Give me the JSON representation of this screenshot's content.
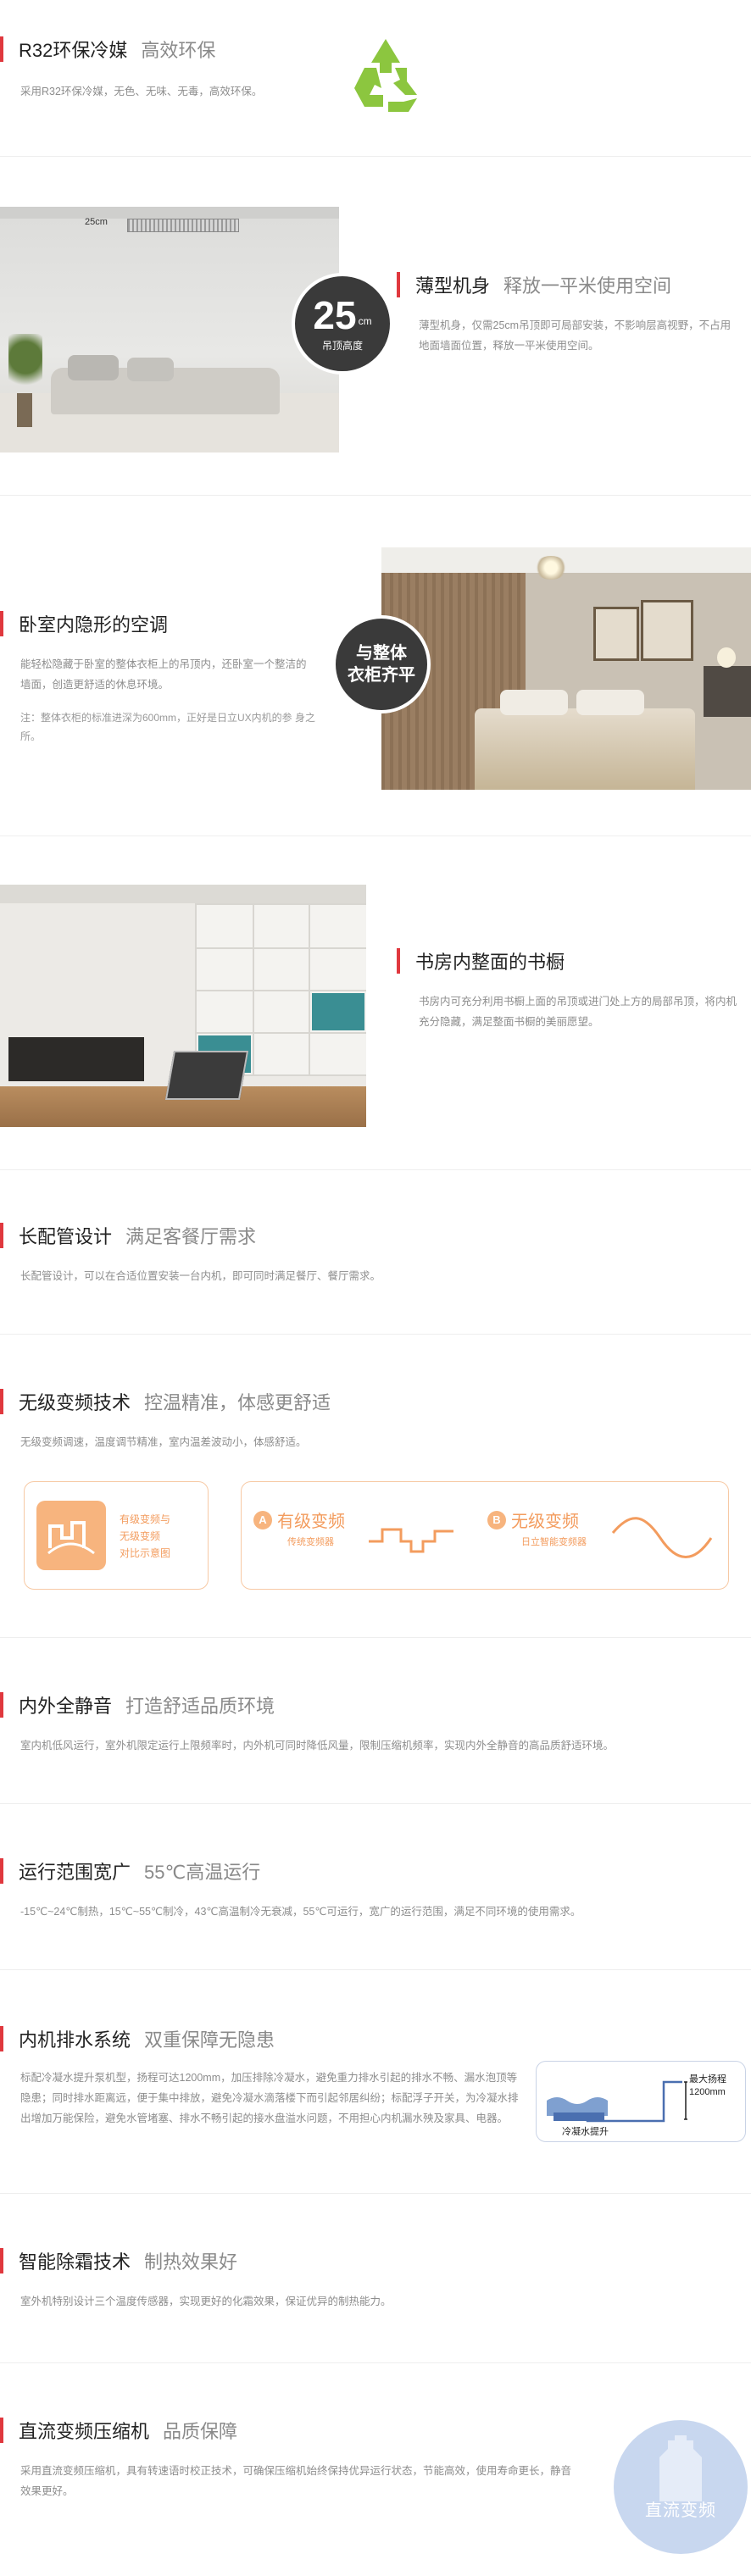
{
  "eco": {
    "title": "R32环保冷媒",
    "subtitle": "高效环保",
    "desc": "采用R32环保冷媒，无色、无味、无毒，高效环保。"
  },
  "slim": {
    "dim_label": "25cm",
    "badge_value": "25",
    "badge_unit": "cm",
    "badge_caption": "吊顶高度",
    "title": "薄型机身",
    "subtitle": "释放一平米使用空间",
    "desc": "薄型机身，仅需25cm吊顶即可局部安装，不影响层高视野，不占用地面墙面位置，释放一平米使用空间。"
  },
  "bedroom": {
    "title": "卧室内隐形的空调",
    "badge_line1": "与整体",
    "badge_line2": "衣柜齐平",
    "desc": "能轻松隐藏于卧室的整体衣柜上的吊顶内，还卧室一个整洁的墙面，创造更舒适的休息环境。",
    "note": "注：整体衣柜的标准进深为600mm，正好是日立UX内机的参 身之所。"
  },
  "study": {
    "title": "书房内整面的书橱",
    "desc": "书房内可充分利用书橱上面的吊顶或进门处上方的局部吊顶，将内机充分隐藏，满足整面书橱的美丽愿望。"
  },
  "pipe": {
    "title": "长配管设计",
    "subtitle": "满足客餐厅需求",
    "desc": "长配管设计，可以在合适位置安装一台内机，即可同时满足餐厅、餐厅需求。"
  },
  "inverter": {
    "title": "无级变频技术",
    "subtitle": "控温精准，体感更舒适",
    "desc": "无级变频调速，温度调节精准，室内温差波动小，体感舒适。",
    "legend_line1": "有级变频与",
    "legend_line2": "无级变频",
    "legend_line3": "对比示意图",
    "a_letter": "A",
    "a_title": "有级变频",
    "a_sub": "传统变频器",
    "b_letter": "B",
    "b_title": "无级变频",
    "b_sub": "日立智能变频器"
  },
  "silent": {
    "title": "内外全静音",
    "subtitle": "打造舒适品质环境",
    "desc": "室内机低风运行，室外机限定运行上限频率时，内外机可同时降低风量，限制压缩机频率，实现内外全静音的高品质舒适环境。"
  },
  "range": {
    "title": "运行范围宽广",
    "subtitle": "55℃高温运行",
    "desc": "-15℃~24℃制热，15℃~55℃制冷，43℃高温制冷无衰减，55℃可运行，宽广的运行范围，满足不同环境的使用需求。"
  },
  "drain": {
    "title": "内机排水系统",
    "subtitle": "双重保障无隐患",
    "desc": "标配冷凝水提升泵机型，扬程可达1200mm，加压排除冷凝水，避免重力排水引起的排水不畅、漏水泡顶等隐患；同时排水距离远，便于集中排放，避免冷凝水滴落楼下而引起邻居纠纷；标配浮子开关，为冷凝水排出增加万能保险，避免水管堵塞、排水不畅引起的接水盘溢水问题，不用担心内机漏水殃及家具、电器。",
    "diagram_max_label1": "最大扬程",
    "diagram_max_label2": "1200mm",
    "diagram_pump_label": "冷凝水提升"
  },
  "defrost": {
    "title": "智能除霜技术",
    "subtitle": "制热效果好",
    "desc": "室外机特别设计三个温度传感器，实现更好的化霜效果，保证优异的制热能力。"
  },
  "compressor": {
    "title": "直流变频压缩机",
    "subtitle": "品质保障",
    "desc": "采用直流变频压缩机，具有转速语时校正技术，可确保压缩机始终保持优异运行状态，节能高效，使用寿命更长，静音效果更好。",
    "badge": "直流变频"
  },
  "colors": {
    "accent": "#e0383e",
    "recycle_green": "#8cc63f",
    "orange": "#f5a66a",
    "badge_blue": "#b8cbea"
  }
}
